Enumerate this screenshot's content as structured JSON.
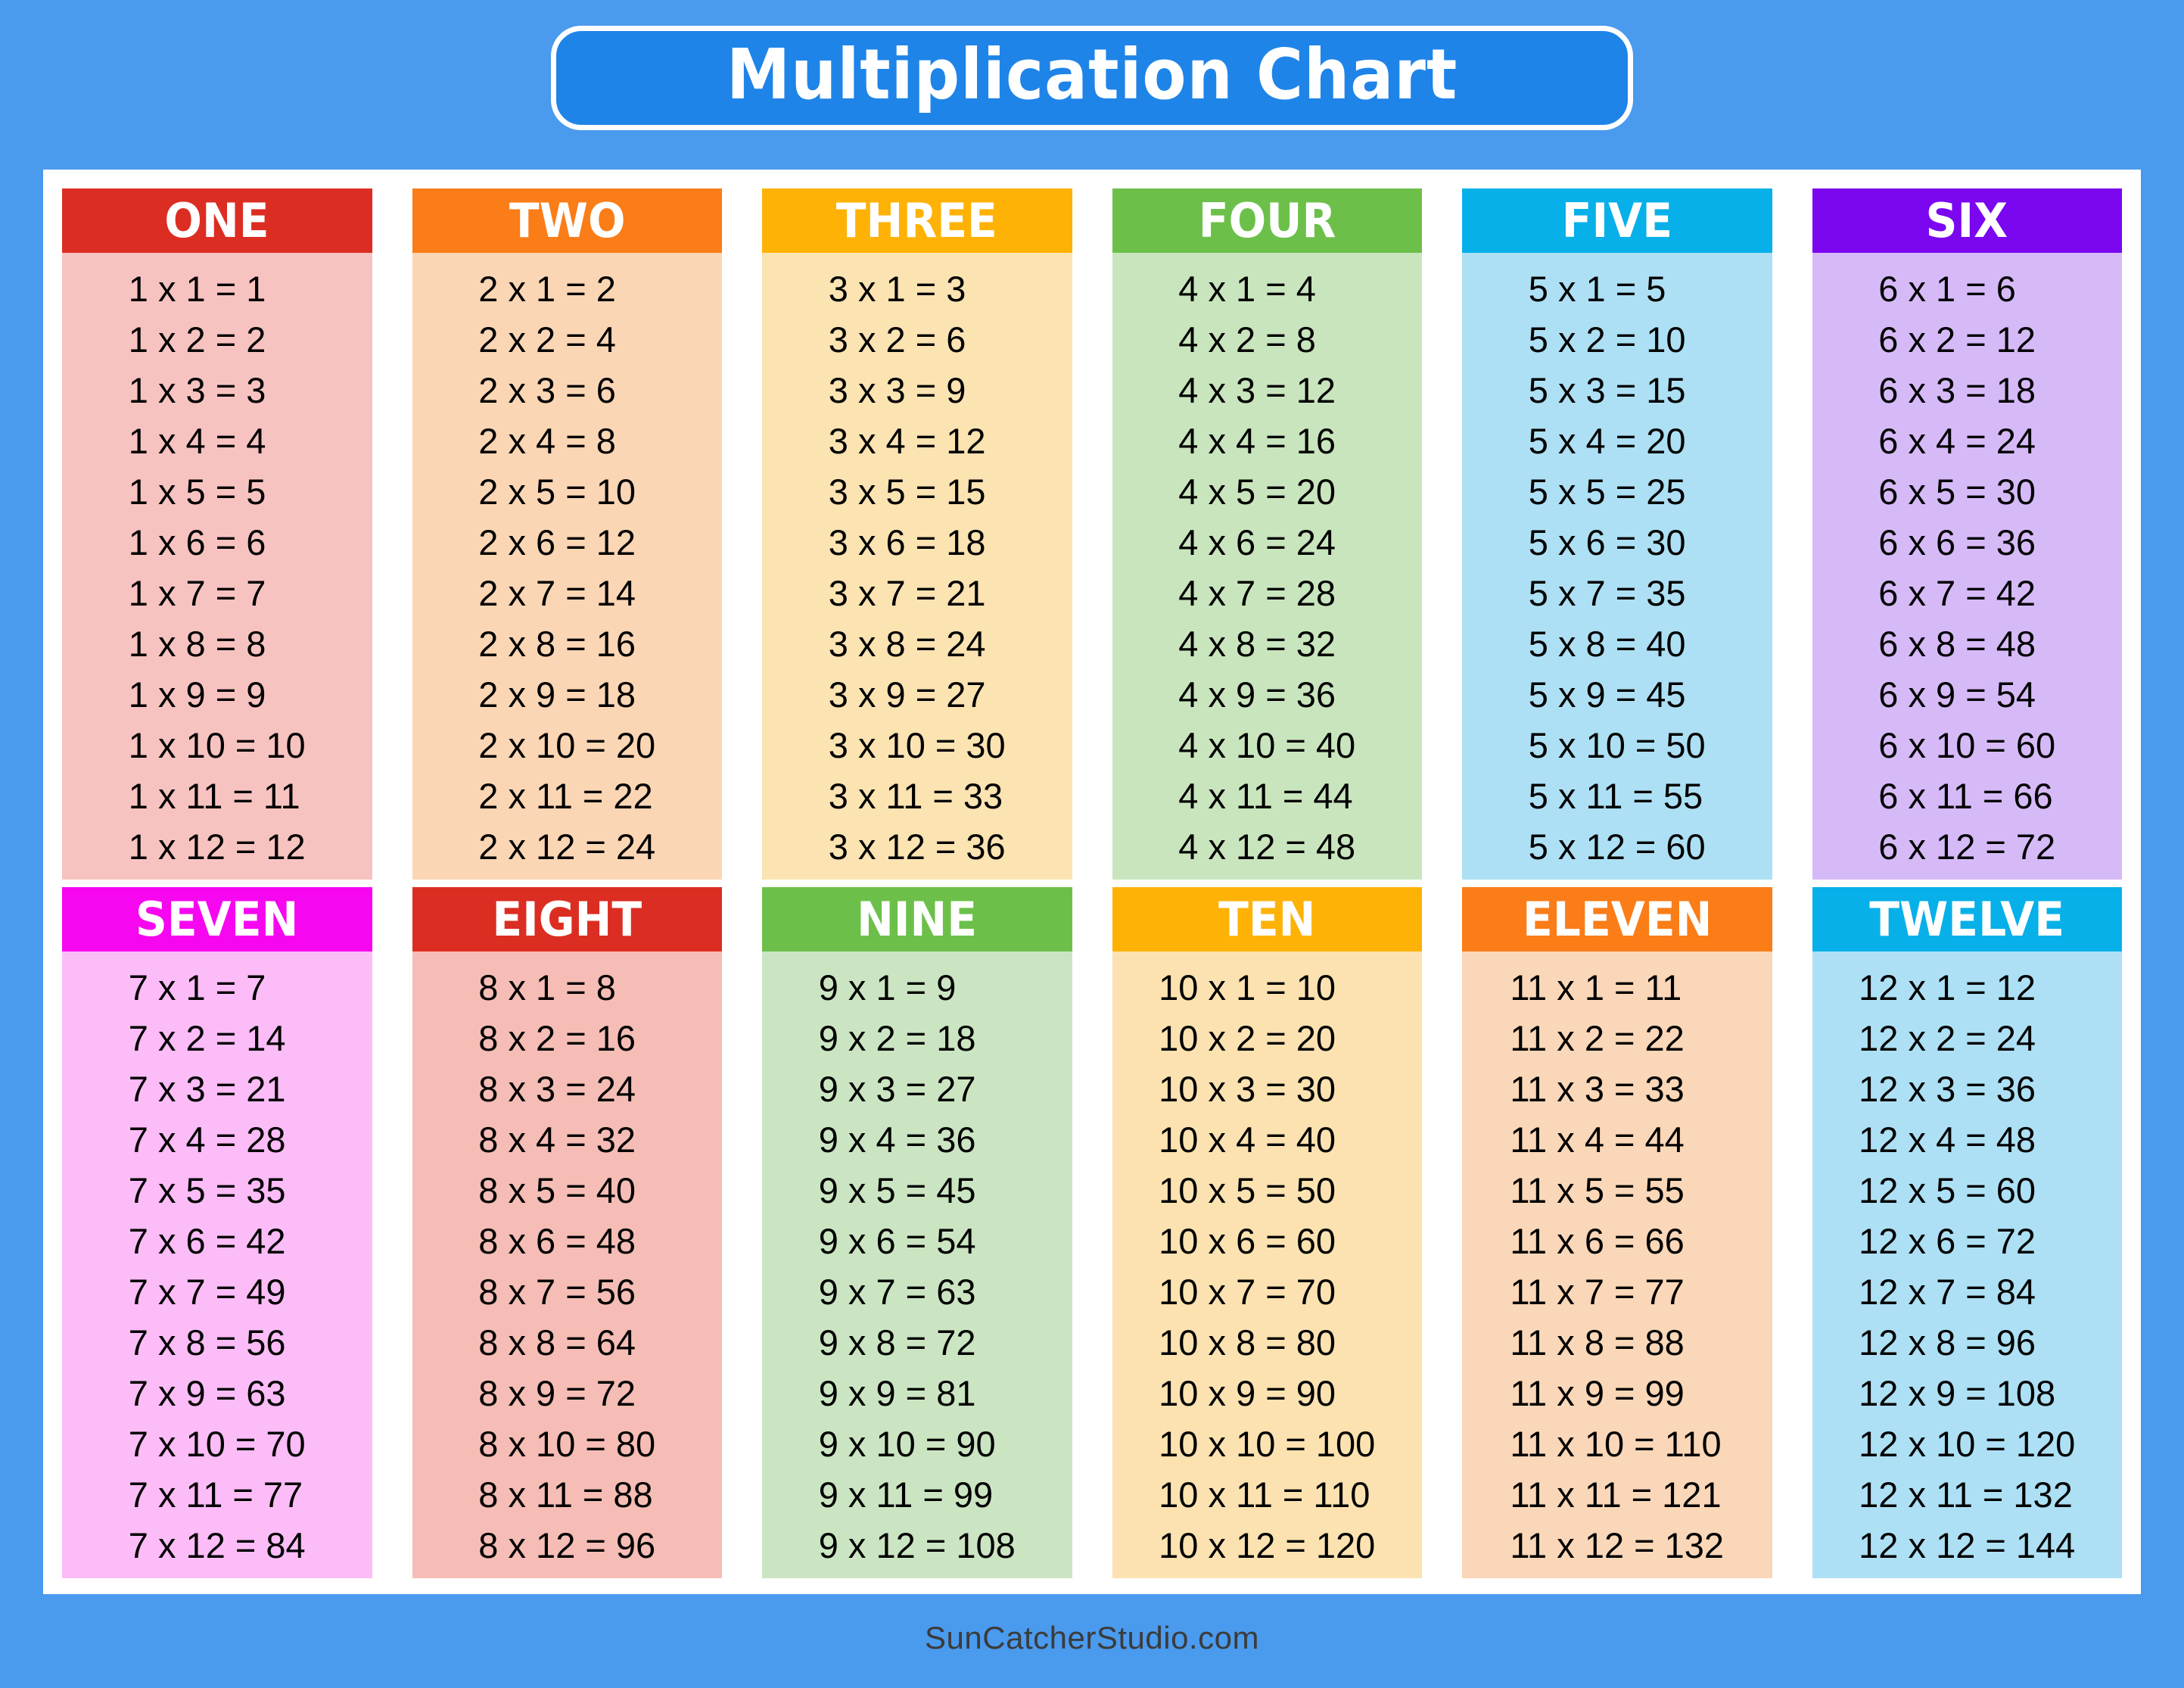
{
  "page": {
    "title": "Multiplication Chart",
    "background_color": "#4a9aee",
    "board_color": "#ffffff",
    "title_fill": "#1f84e8",
    "title_border": "#ffffff",
    "title_text_color": "#ffffff"
  },
  "footer": {
    "credit": "SunCatcherStudio.com",
    "color": "#3b3b3b"
  },
  "chart_data": {
    "type": "table",
    "title": "Multiplication Chart",
    "description": "Twelve multiplication tables, factors 1 through 12, each times 1 through 12.",
    "columns_per_row": 6,
    "rows_of_tables": 2,
    "tables": [
      {
        "label": "ONE",
        "base": 1,
        "header_color": "#dc2d22",
        "body_color": "#f7c3c0",
        "facts": [
          "1 x 1 = 1",
          "1 x 2 = 2",
          "1 x 3 = 3",
          "1 x 4 = 4",
          "1 x 5 = 5",
          "1 x 6 = 6",
          "1 x 7 = 7",
          "1 x 8 = 8",
          "1 x 9 = 9",
          "1 x 10 = 10",
          "1 x 11 = 11",
          "1 x 12 = 12"
        ]
      },
      {
        "label": "TWO",
        "base": 2,
        "header_color": "#fa7d18",
        "body_color": "#fbd6b4",
        "facts": [
          "2 x 1 = 2",
          "2 x 2 = 4",
          "2 x 3 = 6",
          "2 x 4 = 8",
          "2 x 5 = 10",
          "2 x 6 = 12",
          "2 x 7 = 14",
          "2 x 8 = 16",
          "2 x 9 = 18",
          "2 x 10 = 20",
          "2 x 11 = 22",
          "2 x 12 = 24"
        ]
      },
      {
        "label": "THREE",
        "base": 3,
        "header_color": "#feb206",
        "body_color": "#fbe3b2",
        "facts": [
          "3 x 1 = 3",
          "3 x 2 = 6",
          "3 x 3 = 9",
          "3 x 4 = 12",
          "3 x 5 = 15",
          "3 x 6 = 18",
          "3 x 7 = 21",
          "3 x 8 = 24",
          "3 x 9 = 27",
          "3 x 10 = 30",
          "3 x 11 = 33",
          "3 x 12 = 36"
        ]
      },
      {
        "label": "FOUR",
        "base": 4,
        "header_color": "#6cc04a",
        "body_color": "#c9e5bd",
        "facts": [
          "4 x 1 = 4",
          "4 x 2 = 8",
          "4 x 3 = 12",
          "4 x 4 = 16",
          "4 x 5 = 20",
          "4 x 6 = 24",
          "4 x 7 = 28",
          "4 x 8 = 32",
          "4 x 9 = 36",
          "4 x 10 = 40",
          "4 x 11 = 44",
          "4 x 12 = 48"
        ]
      },
      {
        "label": "FIVE",
        "base": 5,
        "header_color": "#07b0e8",
        "body_color": "#ade0f4",
        "facts": [
          "5 x 1 = 5",
          "5 x 2 = 10",
          "5 x 3 = 15",
          "5 x 4 = 20",
          "5 x 5 = 25",
          "5 x 6 = 30",
          "5 x 7 = 35",
          "5 x 8 = 40",
          "5 x 9 = 45",
          "5 x 10 = 50",
          "5 x 11 = 55",
          "5 x 12 = 60"
        ]
      },
      {
        "label": "SIX",
        "base": 6,
        "header_color": "#7b06f0",
        "body_color": "#d6baf8",
        "facts": [
          "6 x 1 = 6",
          "6 x 2 = 12",
          "6 x 3 = 18",
          "6 x 4 = 24",
          "6 x 5 = 30",
          "6 x 6 = 36",
          "6 x 7 = 42",
          "6 x 8 = 48",
          "6 x 9 = 54",
          "6 x 10 = 60",
          "6 x 11 = 66",
          "6 x 12 = 72"
        ]
      },
      {
        "label": "SEVEN",
        "base": 7,
        "header_color": "#f706f0",
        "body_color": "#fcbcf7",
        "facts": [
          "7 x 1 = 7",
          "7 x 2 = 14",
          "7 x 3 = 21",
          "7 x 4 = 28",
          "7 x 5 = 35",
          "7 x 6 = 42",
          "7 x 7 = 49",
          "7 x 8 = 56",
          "7 x 9 = 63",
          "7 x 10 = 70",
          "7 x 11 = 77",
          "7 x 12 = 84"
        ]
      },
      {
        "label": "EIGHT",
        "base": 8,
        "header_color": "#dc2d22",
        "body_color": "#f5bdb5",
        "facts": [
          "8 x 1 = 8",
          "8 x 2 = 16",
          "8 x 3 = 24",
          "8 x 4 = 32",
          "8 x 5 = 40",
          "8 x 6 = 48",
          "8 x 7 = 56",
          "8 x 8 = 64",
          "8 x 9 = 72",
          "8 x 10 = 80",
          "8 x 11 = 88",
          "8 x 12 = 96"
        ]
      },
      {
        "label": "NINE",
        "base": 9,
        "header_color": "#6cc04a",
        "body_color": "#cbe5c2",
        "facts": [
          "9 x 1 = 9",
          "9 x 2 = 18",
          "9 x 3 = 27",
          "9 x 4 = 36",
          "9 x 5 = 45",
          "9 x 6 = 54",
          "9 x 7 = 63",
          "9 x 8 = 72",
          "9 x 9 = 81",
          "9 x 10 = 90",
          "9 x 11 = 99",
          "9 x 12 = 108"
        ]
      },
      {
        "label": "TEN",
        "base": 10,
        "header_color": "#feb206",
        "body_color": "#fbe2b0",
        "facts": [
          "10 x 1 = 10",
          "10 x 2 = 20",
          "10 x 3 = 30",
          "10 x 4 = 40",
          "10 x 5 = 50",
          "10 x 6 = 60",
          "10 x 7 = 70",
          "10 x 8 = 80",
          "10 x 9 = 90",
          "10 x 10 = 100",
          "10 x 11 = 110",
          "10 x 12 = 120"
        ]
      },
      {
        "label": "ELEVEN",
        "base": 11,
        "header_color": "#fa7d18",
        "body_color": "#fad7b8",
        "facts": [
          "11 x 1 = 11",
          "11 x 2 = 22",
          "11 x 3 = 33",
          "11 x 4 = 44",
          "11 x 5 = 55",
          "11 x 6 = 66",
          "11 x 7 = 77",
          "11 x 8 = 88",
          "11 x 9 = 99",
          "11 x 10 = 110",
          "11 x 11 = 121",
          "11 x 12 = 132"
        ]
      },
      {
        "label": "TWELVE",
        "base": 12,
        "header_color": "#07b0e8",
        "body_color": "#ade0f4",
        "facts": [
          "12 x 1 = 12",
          "12 x 2 = 24",
          "12 x 3 = 36",
          "12 x 4 = 48",
          "12 x 5 = 60",
          "12 x 6 = 72",
          "12 x 7 = 84",
          "12 x 8 = 96",
          "12 x 9 = 108",
          "12 x 10 = 120",
          "12 x 11 = 132",
          "12 x 12 = 144"
        ]
      }
    ]
  }
}
